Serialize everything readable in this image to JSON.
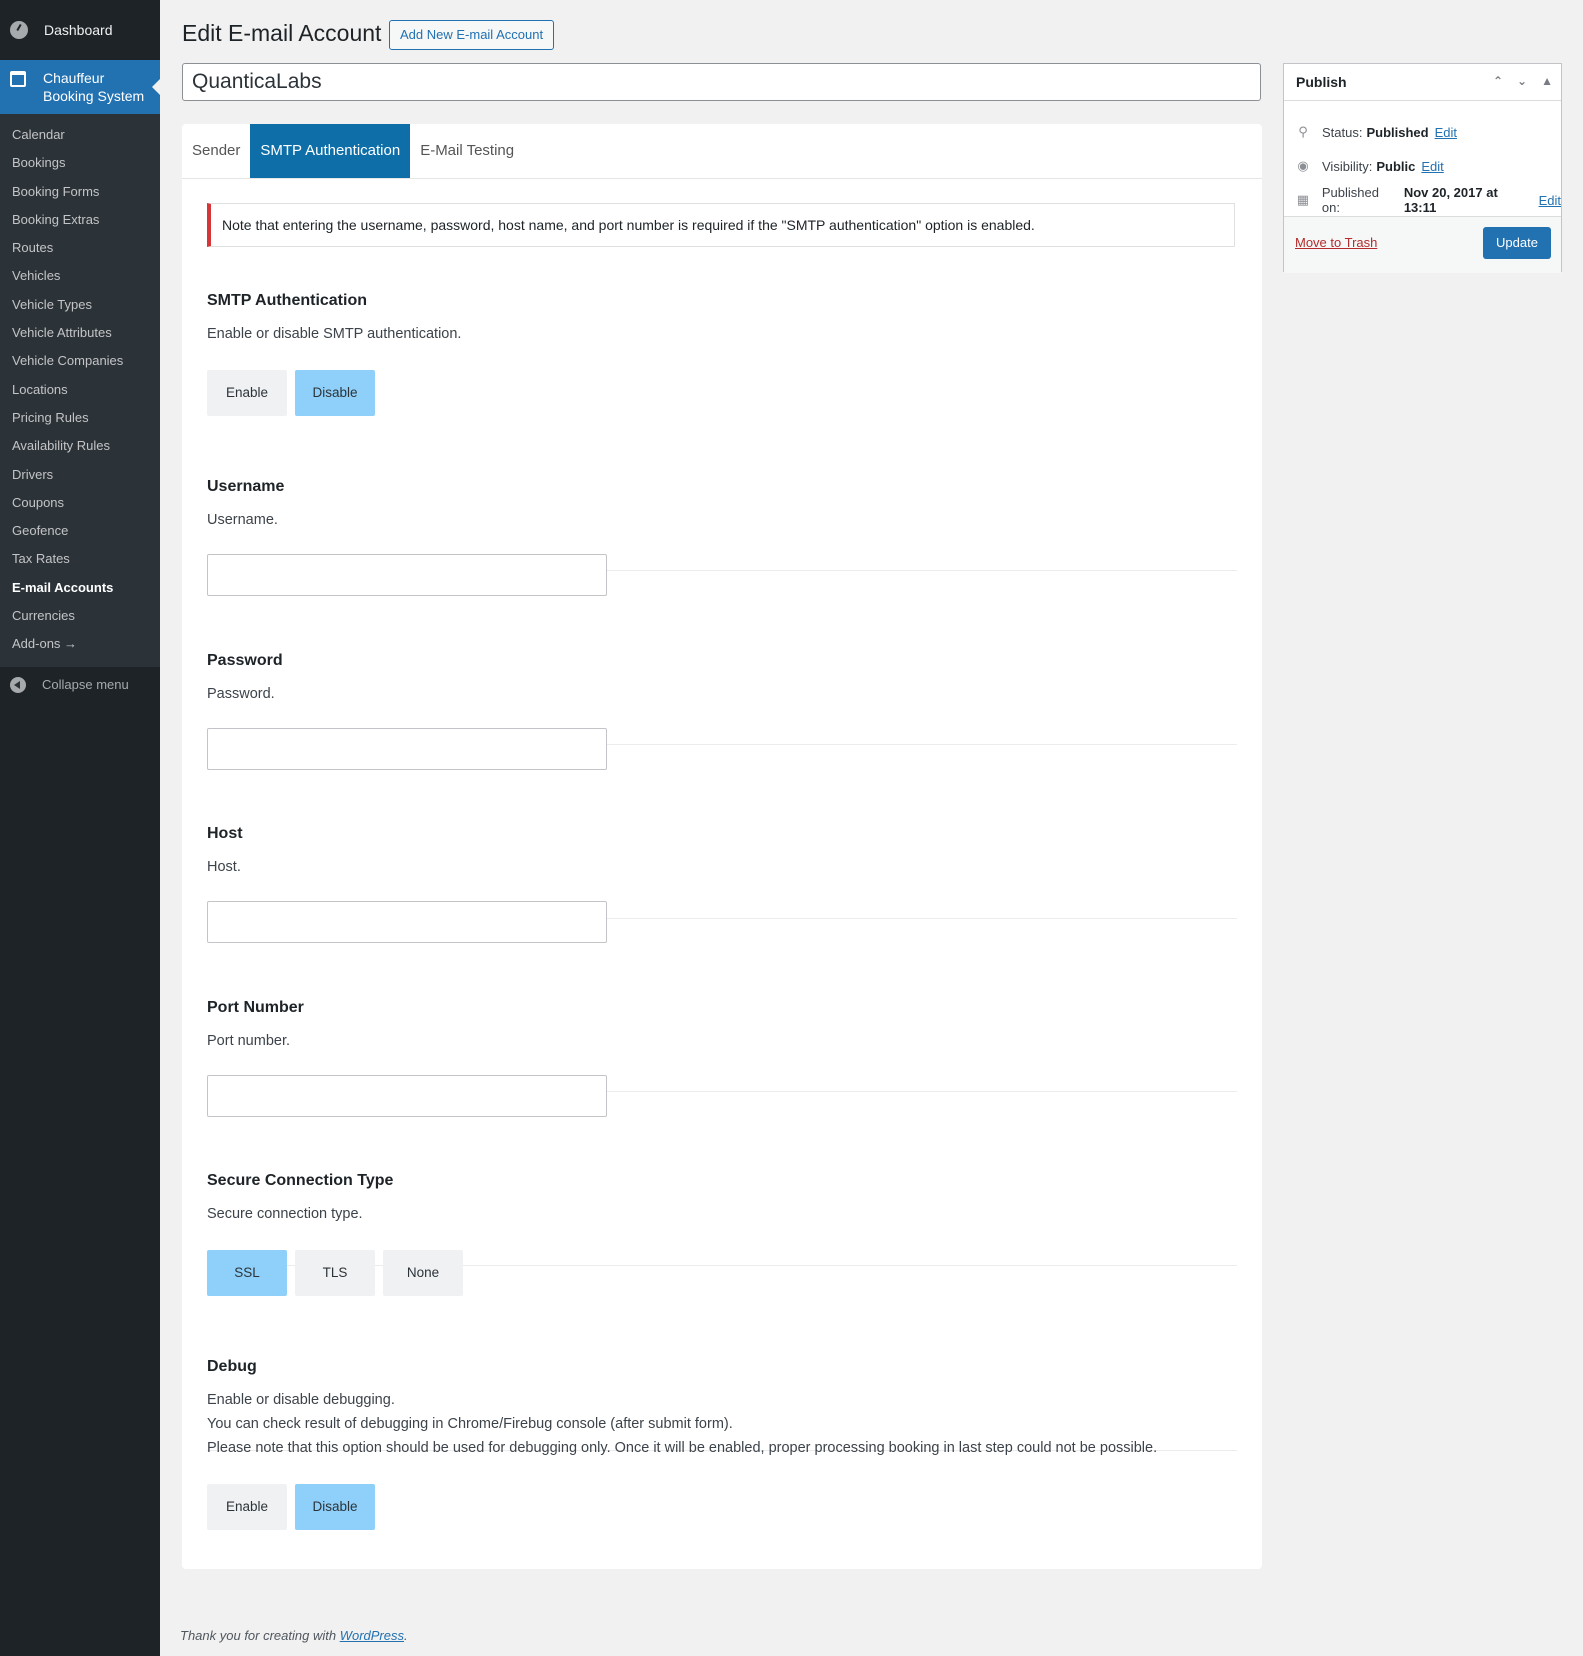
{
  "sidebar": {
    "dashboard_label": "Dashboard",
    "active_label_line1": "Chauffeur",
    "active_label_line2": "Booking System",
    "items": [
      {
        "label": "Calendar"
      },
      {
        "label": "Bookings"
      },
      {
        "label": "Booking Forms"
      },
      {
        "label": "Booking Extras"
      },
      {
        "label": "Routes"
      },
      {
        "label": "Vehicles"
      },
      {
        "label": "Vehicle Types"
      },
      {
        "label": "Vehicle Attributes"
      },
      {
        "label": "Vehicle Companies"
      },
      {
        "label": "Locations"
      },
      {
        "label": "Pricing Rules"
      },
      {
        "label": "Availability Rules"
      },
      {
        "label": "Drivers"
      },
      {
        "label": "Coupons"
      },
      {
        "label": "Geofence"
      },
      {
        "label": "Tax Rates"
      },
      {
        "label": "E-mail Accounts"
      },
      {
        "label": "Currencies"
      },
      {
        "label": "Add-ons →"
      }
    ],
    "collapse_label": "Collapse menu"
  },
  "header": {
    "title": "Edit E-mail Account",
    "add_new_label": "Add New E-mail Account",
    "post_title_value": "QuanticaLabs"
  },
  "tabs": [
    "Sender",
    "SMTP Authentication",
    "E-Mail Testing"
  ],
  "notice": "Note that entering the username, password, host name, and port number is required if the \"SMTP authentication\" option is enabled.",
  "fields": {
    "smtp": {
      "label": "SMTP Authentication",
      "desc": "Enable or disable SMTP authentication.",
      "options": [
        "Enable",
        "Disable"
      ],
      "selected": "Disable"
    },
    "username": {
      "label": "Username",
      "desc": "Username.",
      "value": ""
    },
    "password": {
      "label": "Password",
      "desc": "Password.",
      "value": ""
    },
    "host": {
      "label": "Host",
      "desc": "Host.",
      "value": ""
    },
    "port": {
      "label": "Port Number",
      "desc": "Port number.",
      "value": ""
    },
    "secure": {
      "label": "Secure Connection Type",
      "desc": "Secure connection type.",
      "options": [
        "SSL",
        "TLS",
        "None"
      ],
      "selected": "SSL"
    },
    "debug": {
      "label": "Debug",
      "desc1": "Enable or disable debugging.",
      "desc2": "You can check result of debugging in Chrome/Firebug console (after submit form).",
      "desc3": "Please note that this option should be used for debugging only. Once it will be enabled, proper processing booking in last step could not be possible.",
      "options": [
        "Enable",
        "Disable"
      ],
      "selected": "Disable"
    }
  },
  "publish": {
    "title": "Publish",
    "status_label": "Status:",
    "status_value": "Published",
    "visibility_label": "Visibility:",
    "visibility_value": "Public",
    "published_label": "Published on:",
    "published_value": "Nov 20, 2017 at 13:11",
    "edit_label": "Edit",
    "trash_label": "Move to Trash",
    "update_label": "Update"
  },
  "footer": {
    "text": "Thank you for creating with ",
    "link": "WordPress",
    "end": "."
  }
}
